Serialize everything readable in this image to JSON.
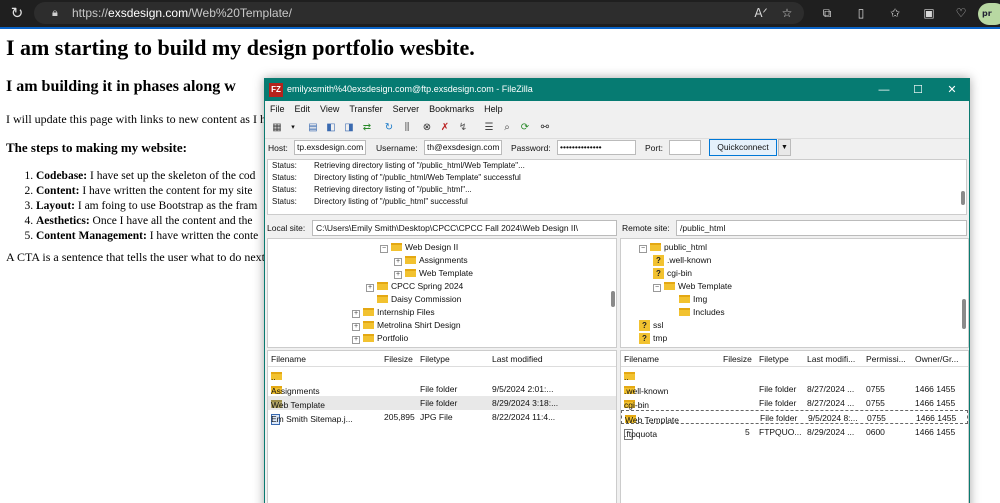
{
  "browser": {
    "url_prefix": "https://",
    "url_host": "exsdesign.com",
    "url_path": "/Web%20Template/",
    "icons": [
      "reload-icon",
      "lock-icon",
      "read-aloud-icon",
      "favorite-star-icon",
      "extensions-icon",
      "split-screen-icon",
      "favorites-icon",
      "collections-icon",
      "browser-essentials-icon"
    ]
  },
  "page": {
    "title": "I am starting to build my design portfolio wesbite.",
    "subtitle": "I am building it in phases along w",
    "intro": "I will update this page with links to new content as I h",
    "steps_heading": "The steps to making my website:",
    "steps": [
      {
        "term": "Codebase:",
        "text": " I have set up the skeleton of the cod"
      },
      {
        "term": "Content:",
        "text": " I have written the content for my site"
      },
      {
        "term": "Layout:",
        "text": " I am foing to use Bootstrap as the fram"
      },
      {
        "term": "Aesthetics:",
        "text": " Once I have all the content and the"
      },
      {
        "term": "Content Management:",
        "text": " I have written the conte"
      }
    ],
    "cta": "A CTA is a sentence that tells the user what to do next"
  },
  "filezilla": {
    "logo": "FZ",
    "title": "emilyxsmith%40exsdesign.com@ftp.exsdesign.com - FileZilla",
    "window_buttons": [
      "—",
      "☐",
      "✕"
    ],
    "menu": [
      "File",
      "Edit",
      "View",
      "Transfer",
      "Server",
      "Bookmarks",
      "Help"
    ],
    "quickconnect": {
      "host_label": "Host:",
      "host_value": "tp.exsdesign.com",
      "user_label": "Username:",
      "user_value": "th@exsdesign.com",
      "pass_label": "Password:",
      "pass_value": "••••••••••••••",
      "port_label": "Port:",
      "port_value": "",
      "button": "Quickconnect"
    },
    "log": [
      {
        "status": "Status:",
        "message": "Retrieving directory listing of \"/public_html/Web Template\"..."
      },
      {
        "status": "Status:",
        "message": "Directory listing of \"/public_html/Web Template\" successful"
      },
      {
        "status": "Status:",
        "message": "Retrieving directory listing of \"/public_html\"..."
      },
      {
        "status": "Status:",
        "message": "Directory listing of \"/public_html\" successful"
      }
    ],
    "local": {
      "site_label": "Local site:",
      "site_path": "C:\\Users\\Emily Smith\\Desktop\\CPCC\\CPCC Fall 2024\\Web Design II\\",
      "tree": [
        {
          "label": "Web Design II",
          "exp": "−"
        },
        {
          "label": "Assignments",
          "exp": "+"
        },
        {
          "label": "Web Template",
          "exp": "+"
        },
        {
          "label": "CPCC Spring 2024",
          "exp": "+"
        },
        {
          "label": "Daisy Commission",
          "exp": ""
        },
        {
          "label": "Internship Files",
          "exp": "+"
        },
        {
          "label": "Metrolina Shirt Design",
          "exp": "+"
        },
        {
          "label": "Portfolio",
          "exp": "+"
        }
      ],
      "columns": [
        "Filename",
        "Filesize",
        "Filetype",
        "Last modified"
      ],
      "rows": [
        {
          "name": "..",
          "size": "",
          "type": "",
          "modified": ""
        },
        {
          "name": "Assignments",
          "size": "",
          "type": "File folder",
          "modified": "9/5/2024 2:01:..."
        },
        {
          "name": "Web Template",
          "size": "",
          "type": "File folder",
          "modified": "8/29/2024 3:18:..."
        },
        {
          "name": "Em Smith Sitemap.j...",
          "size": "205,895",
          "type": "JPG File",
          "modified": "8/22/2024 11:4..."
        }
      ]
    },
    "remote": {
      "site_label": "Remote site:",
      "site_path": "/public_html",
      "tree": [
        {
          "label": "public_html",
          "exp": "−",
          "q": false
        },
        {
          "label": ".well-known",
          "exp": "",
          "q": true
        },
        {
          "label": "cgi-bin",
          "exp": "",
          "q": true
        },
        {
          "label": "Web Template",
          "exp": "−",
          "q": false
        },
        {
          "label": "Img",
          "exp": "",
          "q": false
        },
        {
          "label": "Includes",
          "exp": "",
          "q": false
        },
        {
          "label": "ssl",
          "exp": "",
          "q": true
        },
        {
          "label": "tmp",
          "exp": "",
          "q": true
        }
      ],
      "columns": [
        "Filename",
        "Filesize",
        "Filetype",
        "Last modifi...",
        "Permissi...",
        "Owner/Gr..."
      ],
      "rows": [
        {
          "name": "..",
          "size": "",
          "type": "",
          "modified": "",
          "perm": "",
          "owner": ""
        },
        {
          "name": ".well-known",
          "size": "",
          "type": "File folder",
          "modified": "8/27/2024 ...",
          "perm": "0755",
          "owner": "1466 1455"
        },
        {
          "name": "cgi-bin",
          "size": "",
          "type": "File folder",
          "modified": "8/27/2024 ...",
          "perm": "0755",
          "owner": "1466 1455"
        },
        {
          "name": "Web Template",
          "size": "",
          "type": "File folder",
          "modified": "9/5/2024 8:...",
          "perm": "0755",
          "owner": "1466 1455"
        },
        {
          "name": ".ftpquota",
          "size": "5",
          "type": "FTPQUO...",
          "modified": "8/29/2024 ...",
          "perm": "0600",
          "owner": "1466 1455"
        }
      ]
    }
  }
}
